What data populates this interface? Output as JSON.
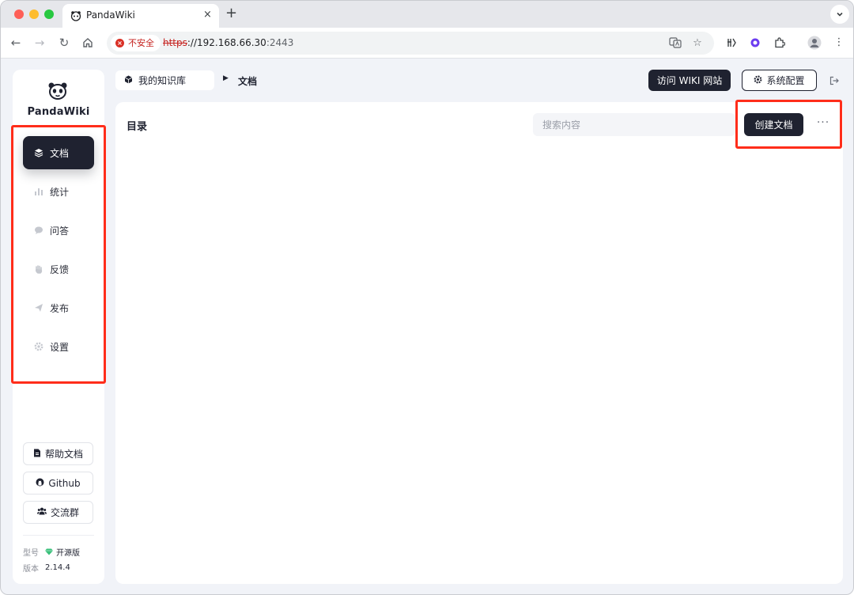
{
  "browser": {
    "tab_title": "PandaWiki",
    "tab_close": "×",
    "new_tab": "+",
    "security_label": "不安全",
    "url_scheme": "https",
    "url_rest": "://192.168.66.30",
    "url_port": ":2443",
    "icons": [
      "back-icon",
      "forward-icon",
      "reload-icon",
      "home-icon",
      "translate-icon",
      "star-icon",
      "extension-icon",
      "profile-icon",
      "kebab-menu-icon"
    ]
  },
  "sidebar": {
    "brand": "PandaWiki",
    "items": [
      {
        "label": "文档",
        "icon": "layers-icon",
        "active": true
      },
      {
        "label": "统计",
        "icon": "bar-chart-icon",
        "active": false
      },
      {
        "label": "问答",
        "icon": "chat-bubble-icon",
        "active": false
      },
      {
        "label": "反馈",
        "icon": "hand-icon",
        "active": false
      },
      {
        "label": "发布",
        "icon": "send-icon",
        "active": false
      },
      {
        "label": "设置",
        "icon": "gear-icon",
        "active": false
      }
    ],
    "links": [
      {
        "label": "帮助文档",
        "icon": "document-icon"
      },
      {
        "label": "Github",
        "icon": "github-icon"
      },
      {
        "label": "交流群",
        "icon": "group-icon"
      }
    ],
    "edition_label": "型号",
    "edition_value": "开源版",
    "version_label": "版本",
    "version_value": "2.14.4"
  },
  "header": {
    "breadcrumb_root": "我的知识库",
    "breadcrumb_current": "文档",
    "visit_button": "访问 WIKI 网站",
    "settings_button": "系统配置"
  },
  "main": {
    "title": "目录",
    "search_placeholder": "搜索内容",
    "create_button": "创建文档",
    "more_label": "···"
  },
  "colors": {
    "primary": "#1f2230",
    "highlight": "#ff2d1a",
    "insecure": "#d93025"
  }
}
